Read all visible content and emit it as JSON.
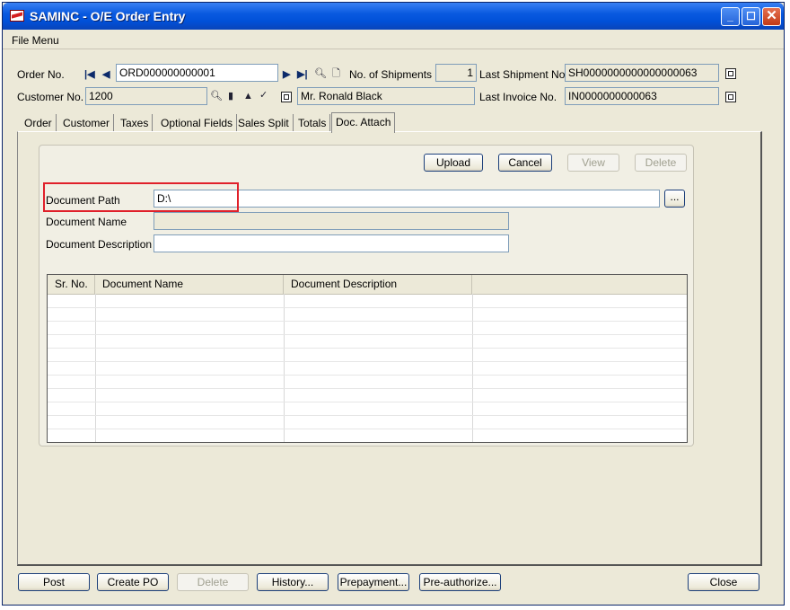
{
  "window": {
    "title": "SAMINC - O/E Order Entry"
  },
  "menu": {
    "file": "File Menu"
  },
  "header": {
    "order_no_label": "Order No.",
    "order_no": "ORD000000000001",
    "shipments_label": "No. of Shipments",
    "shipments": "1",
    "last_shipment_label": "Last Shipment No.",
    "last_shipment": "SH0000000000000000063",
    "customer_no_label": "Customer No.",
    "customer_no": "1200",
    "customer_name": "Mr. Ronald Black",
    "last_invoice_label": "Last Invoice No.",
    "last_invoice": "IN0000000000063"
  },
  "tabs": [
    "Order",
    "Customer",
    "Taxes",
    "Optional Fields",
    "Sales Split",
    "Totals",
    "Doc. Attach"
  ],
  "active_tab": "Doc. Attach",
  "doc_attach": {
    "upload": "Upload",
    "cancel": "Cancel",
    "view": "View",
    "delete": "Delete",
    "path_label": "Document Path",
    "path_value": "D:\\",
    "browse": "...",
    "name_label": "Document Name",
    "name_value": "",
    "desc_label": "Document Description",
    "desc_value": "",
    "columns": [
      "Sr. No.",
      "Document Name",
      "Document Description",
      ""
    ],
    "rows": []
  },
  "footer": {
    "post": "Post",
    "create_po": "Create PO",
    "delete": "Delete",
    "history": "History...",
    "prepayment": "Prepayment...",
    "preauthorize": "Pre-authorize...",
    "close": "Close"
  },
  "colors": {
    "highlight": "#e0202a",
    "titlebar": "#0a5ae0"
  },
  "icons": [
    "app-icon",
    "first-record-icon",
    "previous-record-icon",
    "next-record-icon",
    "last-record-icon",
    "finder-icon",
    "new-document-icon",
    "zoom-icon",
    "notes-icon",
    "up-icon",
    "check-icon",
    "drilldown-icon"
  ]
}
